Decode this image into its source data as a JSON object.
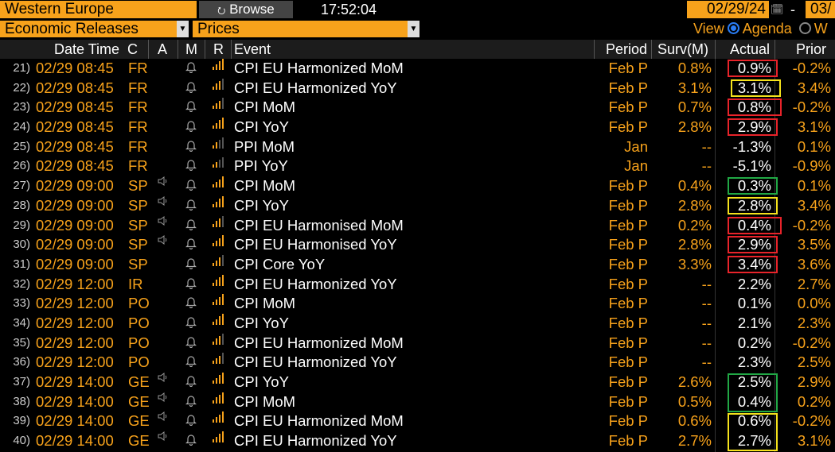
{
  "toolbar": {
    "region": "Western Europe",
    "browse_label": "Browse",
    "clock": "17:52:04",
    "start_date": "02/29/24",
    "dash": "-",
    "end_date": "03/",
    "category": "Economic Releases",
    "subcategory": "Prices",
    "view_label": "View",
    "agenda_label": "Agenda",
    "w_label": "W"
  },
  "columns": {
    "datetime": "Date Time",
    "c": "C",
    "a": "A",
    "m": "M",
    "r": "R",
    "event": "Event",
    "period": "Period",
    "survey": "Surv(M)",
    "actual": "Actual",
    "prior": "Prior"
  },
  "colors": {
    "accent": "#f7a21b",
    "box_red": "#e8232a",
    "box_yellow": "#f5e21b",
    "box_green": "#21a845"
  },
  "rows": [
    {
      "num": "21)",
      "dt": "02/29 08:45",
      "cc": "FR",
      "audio": false,
      "signal": 4,
      "event": "CPI EU Harmonized MoM",
      "period": "Feb P",
      "survey": "0.8%",
      "actual": "0.9%",
      "prior": "-0.2%",
      "box": "red"
    },
    {
      "num": "22)",
      "dt": "02/29 08:45",
      "cc": "FR",
      "audio": false,
      "signal": 3,
      "event": "CPI EU Harmonized YoY",
      "period": "Feb P",
      "survey": "3.1%",
      "actual": "3.1%",
      "prior": "3.4%",
      "box": "yellow"
    },
    {
      "num": "23)",
      "dt": "02/29 08:45",
      "cc": "FR",
      "audio": false,
      "signal": 3,
      "event": "CPI MoM",
      "period": "Feb P",
      "survey": "0.7%",
      "actual": "0.8%",
      "prior": "-0.2%",
      "box": "red"
    },
    {
      "num": "24)",
      "dt": "02/29 08:45",
      "cc": "FR",
      "audio": false,
      "signal": 4,
      "event": "CPI YoY",
      "period": "Feb P",
      "survey": "2.8%",
      "actual": "2.9%",
      "prior": "3.1%",
      "box": "red"
    },
    {
      "num": "25)",
      "dt": "02/29 08:45",
      "cc": "FR",
      "audio": false,
      "signal": 2,
      "event": "PPI MoM",
      "period": "Jan",
      "survey": "--",
      "actual": "-1.3%",
      "prior": "0.1%",
      "box": ""
    },
    {
      "num": "26)",
      "dt": "02/29 08:45",
      "cc": "FR",
      "audio": false,
      "signal": 2,
      "event": "PPI YoY",
      "period": "Jan",
      "survey": "--",
      "actual": "-5.1%",
      "prior": "-0.9%",
      "box": ""
    },
    {
      "num": "27)",
      "dt": "02/29 09:00",
      "cc": "SP",
      "audio": true,
      "signal": 4,
      "event": "CPI MoM",
      "period": "Feb P",
      "survey": "0.4%",
      "actual": "0.3%",
      "prior": "0.1%",
      "box": "green"
    },
    {
      "num": "28)",
      "dt": "02/29 09:00",
      "cc": "SP",
      "audio": true,
      "signal": 4,
      "event": "CPI YoY",
      "period": "Feb P",
      "survey": "2.8%",
      "actual": "2.8%",
      "prior": "3.4%",
      "box": "yellow"
    },
    {
      "num": "29)",
      "dt": "02/29 09:00",
      "cc": "SP",
      "audio": true,
      "signal": 3,
      "event": "CPI EU Harmonised MoM",
      "period": "Feb P",
      "survey": "0.2%",
      "actual": "0.4%",
      "prior": "-0.2%",
      "box": "red"
    },
    {
      "num": "30)",
      "dt": "02/29 09:00",
      "cc": "SP",
      "audio": true,
      "signal": 4,
      "event": "CPI EU Harmonised YoY",
      "period": "Feb P",
      "survey": "2.8%",
      "actual": "2.9%",
      "prior": "3.5%",
      "box": "red"
    },
    {
      "num": "31)",
      "dt": "02/29 09:00",
      "cc": "SP",
      "audio": false,
      "signal": 3,
      "event": "CPI Core YoY",
      "period": "Feb P",
      "survey": "3.3%",
      "actual": "3.4%",
      "prior": "3.6%",
      "box": "red"
    },
    {
      "num": "32)",
      "dt": "02/29 12:00",
      "cc": "IR",
      "audio": false,
      "signal": 4,
      "event": "CPI EU Harmonized YoY",
      "period": "Feb P",
      "survey": "--",
      "actual": "2.2%",
      "prior": "2.7%",
      "box": ""
    },
    {
      "num": "33)",
      "dt": "02/29 12:00",
      "cc": "PO",
      "audio": false,
      "signal": 4,
      "event": "CPI MoM",
      "period": "Feb P",
      "survey": "--",
      "actual": "0.1%",
      "prior": "0.0%",
      "box": ""
    },
    {
      "num": "34)",
      "dt": "02/29 12:00",
      "cc": "PO",
      "audio": false,
      "signal": 4,
      "event": "CPI YoY",
      "period": "Feb P",
      "survey": "--",
      "actual": "2.1%",
      "prior": "2.3%",
      "box": ""
    },
    {
      "num": "35)",
      "dt": "02/29 12:00",
      "cc": "PO",
      "audio": false,
      "signal": 3,
      "event": "CPI EU Harmonized MoM",
      "period": "Feb P",
      "survey": "--",
      "actual": "0.2%",
      "prior": "-0.2%",
      "box": ""
    },
    {
      "num": "36)",
      "dt": "02/29 12:00",
      "cc": "PO",
      "audio": false,
      "signal": 3,
      "event": "CPI EU Harmonized YoY",
      "period": "Feb P",
      "survey": "--",
      "actual": "2.3%",
      "prior": "2.5%",
      "box": ""
    },
    {
      "num": "37)",
      "dt": "02/29 14:00",
      "cc": "GE",
      "audio": true,
      "signal": 4,
      "event": "CPI YoY",
      "period": "Feb P",
      "survey": "2.6%",
      "actual": "2.5%",
      "prior": "2.9%",
      "box": "green-top"
    },
    {
      "num": "38)",
      "dt": "02/29 14:00",
      "cc": "GE",
      "audio": true,
      "signal": 4,
      "event": "CPI MoM",
      "period": "Feb P",
      "survey": "0.5%",
      "actual": "0.4%",
      "prior": "0.2%",
      "box": "green-bottom"
    },
    {
      "num": "39)",
      "dt": "02/29 14:00",
      "cc": "GE",
      "audio": true,
      "signal": 4,
      "event": "CPI EU Harmonized MoM",
      "period": "Feb P",
      "survey": "0.6%",
      "actual": "0.6%",
      "prior": "-0.2%",
      "box": "yellow-top"
    },
    {
      "num": "40)",
      "dt": "02/29 14:00",
      "cc": "GE",
      "audio": true,
      "signal": 4,
      "event": "CPI EU Harmonized YoY",
      "period": "Feb P",
      "survey": "2.7%",
      "actual": "2.7%",
      "prior": "3.1%",
      "box": "yellow-bottom"
    }
  ]
}
